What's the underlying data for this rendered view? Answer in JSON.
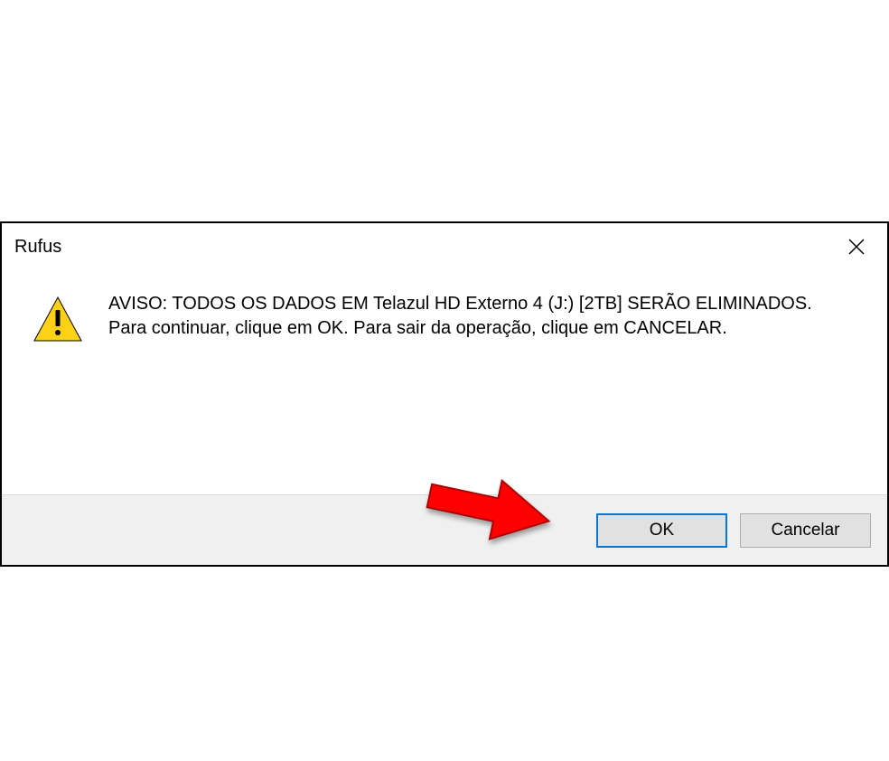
{
  "dialog": {
    "title": "Rufus",
    "message": "AVISO: TODOS OS DADOS EM Telazul HD Externo 4 (J:) [2TB] SERÃO ELIMINADOS.\nPara continuar, clique em OK. Para sair da operação, clique em CANCELAR.",
    "buttons": {
      "ok": "OK",
      "cancel": "Cancelar"
    }
  }
}
